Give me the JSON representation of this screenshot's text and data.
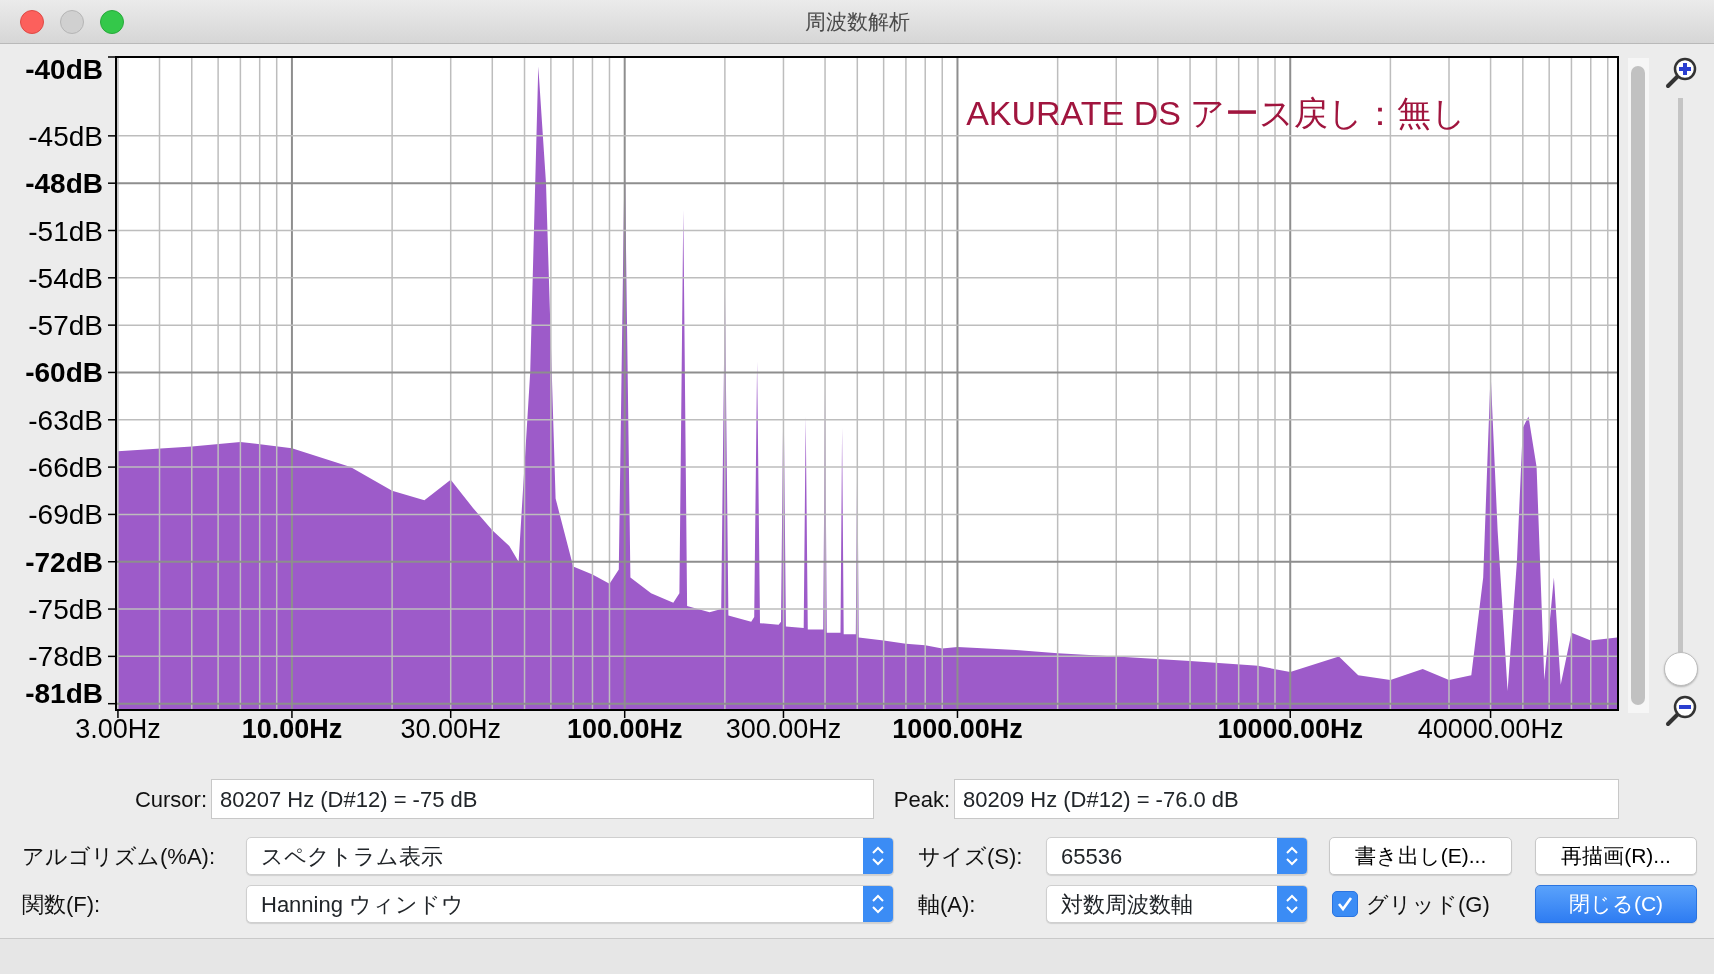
{
  "window": {
    "title": "周波数解析"
  },
  "plot": {
    "y_axis_labels": [
      "-40dB",
      "-45dB",
      "-48dB",
      "-51dB",
      "-54dB",
      "-57dB",
      "-60dB",
      "-63dB",
      "-66dB",
      "-69dB",
      "-72dB",
      "-75dB",
      "-78dB",
      "-81dB"
    ],
    "x_axis_labels": [
      "3.00Hz",
      "10.00Hz",
      "30.00Hz",
      "100.00Hz",
      "300.00Hz",
      "1000.00Hz",
      "10000.00Hz",
      "40000.00Hz"
    ],
    "annotation": "AKURATE DS アース戻し：無し"
  },
  "zoom_slider": {
    "level": 0
  },
  "cursor": {
    "label": "Cursor:",
    "value": "80207 Hz (D#12) = -75 dB"
  },
  "peak": {
    "label": "Peak:",
    "value": "80209 Hz (D#12) = -76.0 dB"
  },
  "algorithm": {
    "label": "アルゴリズム(%A):",
    "value": "スペクトラム表示"
  },
  "size": {
    "label": "サイズ(S):",
    "value": "65536"
  },
  "export_button": "書き出し(E)...",
  "replot_button": "再描画(R)...",
  "function": {
    "label": "関数(F):",
    "value": "Hanning ウィンドウ"
  },
  "axis": {
    "label": "軸(A):",
    "value": "対数周波数軸"
  },
  "grid": {
    "label": "グリッド(G)",
    "checked": true
  },
  "close_button": "閉じる(C)"
}
